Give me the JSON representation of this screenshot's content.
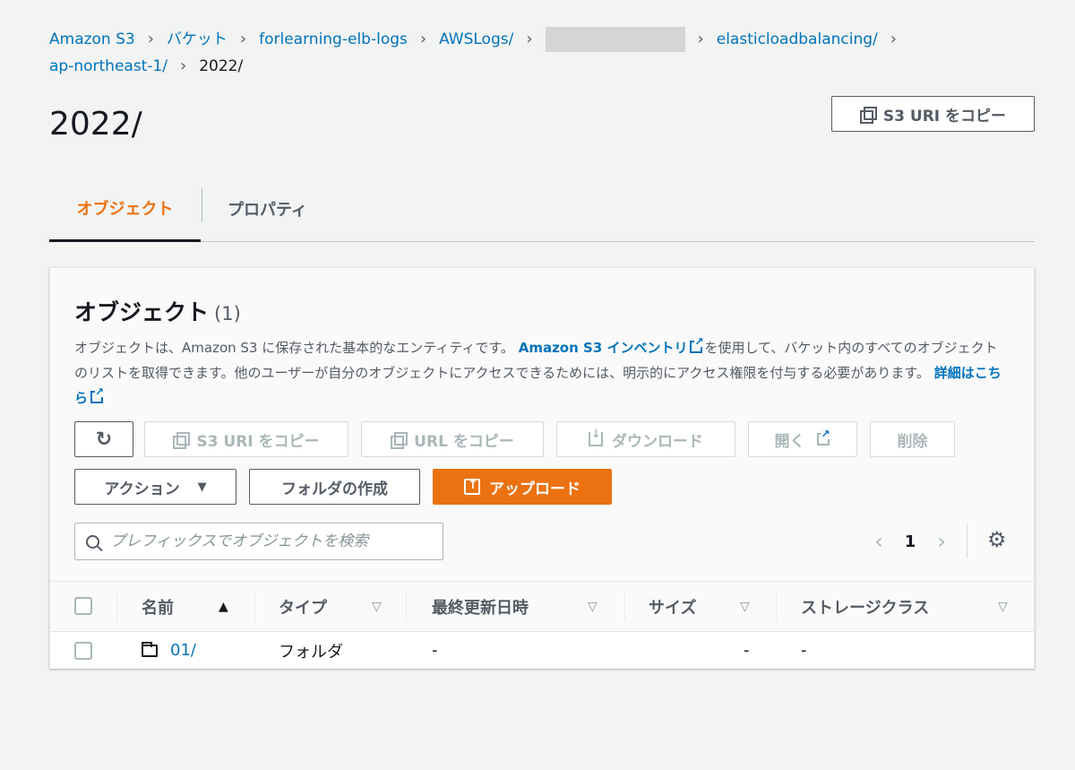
{
  "breadcrumb": {
    "items": [
      "Amazon S3",
      "バケット",
      "forlearning-elb-logs",
      "AWSLogs/",
      "elasticloadbalancing/",
      "ap-northeast-1/"
    ],
    "current": "2022/",
    "separator": "›"
  },
  "page": {
    "title": "2022/",
    "copy_uri_label": "S3 URI をコピー"
  },
  "tabs": [
    {
      "label": "オブジェクト",
      "active": true
    },
    {
      "label": "プロパティ",
      "active": false
    }
  ],
  "objects_panel": {
    "title": "オブジェクト",
    "count": "(1)",
    "desc_part1": "オブジェクトは、Amazon S3 に保存された基本的なエンティティです。",
    "inventory_link": "Amazon S3 インベントリ",
    "desc_part2": "を使用して、バケット内のすべてのオブジェクトのリストを取得できます。他のユーザーが自分のオブジェクトにアクセスできるためには、明示的にアクセス権限を付与する必要があります。",
    "learn_more_link": "詳細はこちら"
  },
  "toolbar": {
    "refresh_icon": "refresh-icon",
    "copy_s3_uri": "S3 URI をコピー",
    "copy_url": "URL をコピー",
    "download": "ダウンロード",
    "open": "開く",
    "delete": "削除",
    "actions": "アクション",
    "create_folder": "フォルダの作成",
    "upload": "アップロード"
  },
  "search": {
    "placeholder": "プレフィックスでオブジェクトを検索"
  },
  "pagination": {
    "current_page": "1"
  },
  "table": {
    "columns": [
      "名前",
      "タイプ",
      "最終更新日時",
      "サイズ",
      "ストレージクラス"
    ],
    "rows": [
      {
        "name": "01/",
        "type": "フォルダ",
        "last_modified": "-",
        "size": "-",
        "storage_class": "-"
      }
    ]
  },
  "colors": {
    "accent": "#ec7211",
    "link": "#0073bb",
    "text": "#16191f",
    "background": "#f2f3f3"
  }
}
